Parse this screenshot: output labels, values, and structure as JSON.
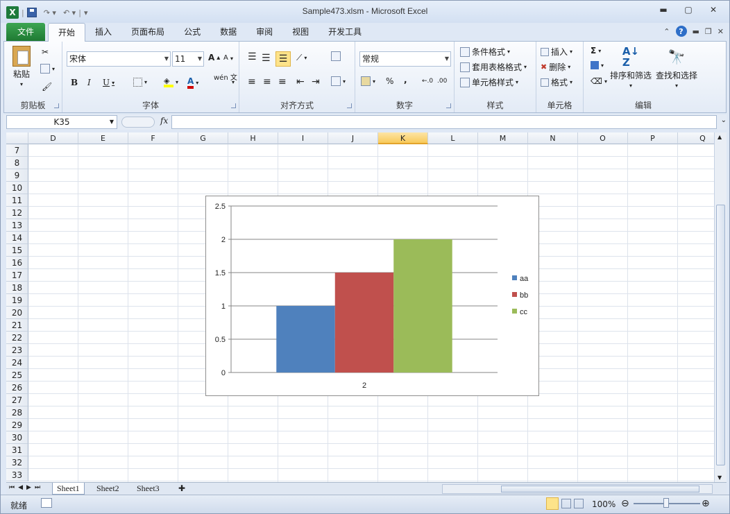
{
  "window": {
    "title": "Sample473.xlsm  -  Microsoft Excel"
  },
  "tabs": [
    "文件",
    "开始",
    "插入",
    "页面布局",
    "公式",
    "数据",
    "审阅",
    "视图",
    "开发工具"
  ],
  "ribbon": {
    "clipboard": {
      "label": "剪贴板",
      "paste": "粘贴"
    },
    "font": {
      "label": "字体",
      "name": "宋体",
      "size": "11",
      "bold": "B",
      "italic": "I",
      "underline": "U",
      "grow": "A",
      "shrink": "A",
      "wen": "wén 文"
    },
    "alignment": {
      "label": "对齐方式"
    },
    "number": {
      "label": "数字",
      "format": "常规",
      "percent": "%",
      "comma": ","
    },
    "styles": {
      "label": "样式",
      "items": [
        "条件格式",
        "套用表格格式",
        "单元格样式"
      ]
    },
    "cells": {
      "label": "单元格",
      "items": [
        "插入",
        "删除",
        "格式"
      ]
    },
    "editing": {
      "label": "编辑",
      "sort": "排序和筛选",
      "find": "查找和选择",
      "sigma": "Σ"
    }
  },
  "formula_bar": {
    "name_box": "K35",
    "fx": "fx",
    "value": ""
  },
  "columns": [
    "D",
    "E",
    "F",
    "G",
    "H",
    "I",
    "J",
    "K",
    "L",
    "M",
    "N",
    "O",
    "P",
    "Q"
  ],
  "selected_column": "K",
  "rows": [
    "7",
    "8",
    "9",
    "10",
    "11",
    "12",
    "13",
    "14",
    "15",
    "16",
    "17",
    "18",
    "19",
    "20",
    "21",
    "22",
    "23",
    "24",
    "25",
    "26",
    "27",
    "28",
    "29",
    "30",
    "31",
    "32",
    "33"
  ],
  "sheets": [
    "Sheet1",
    "Sheet2",
    "Sheet3"
  ],
  "status": {
    "ready": "就绪",
    "zoom": "100%"
  },
  "chart_data": {
    "type": "bar",
    "categories": [
      "2"
    ],
    "series": [
      {
        "name": "aa",
        "values": [
          1
        ],
        "color": "#4f81bd"
      },
      {
        "name": "bb",
        "values": [
          1.5
        ],
        "color": "#c0504d"
      },
      {
        "name": "cc",
        "values": [
          2
        ],
        "color": "#9bbb59"
      }
    ],
    "yticks": [
      "0",
      "0.5",
      "1",
      "1.5",
      "2",
      "2.5"
    ],
    "ylim": [
      0,
      2.5
    ],
    "grid": true,
    "legend": "right"
  }
}
